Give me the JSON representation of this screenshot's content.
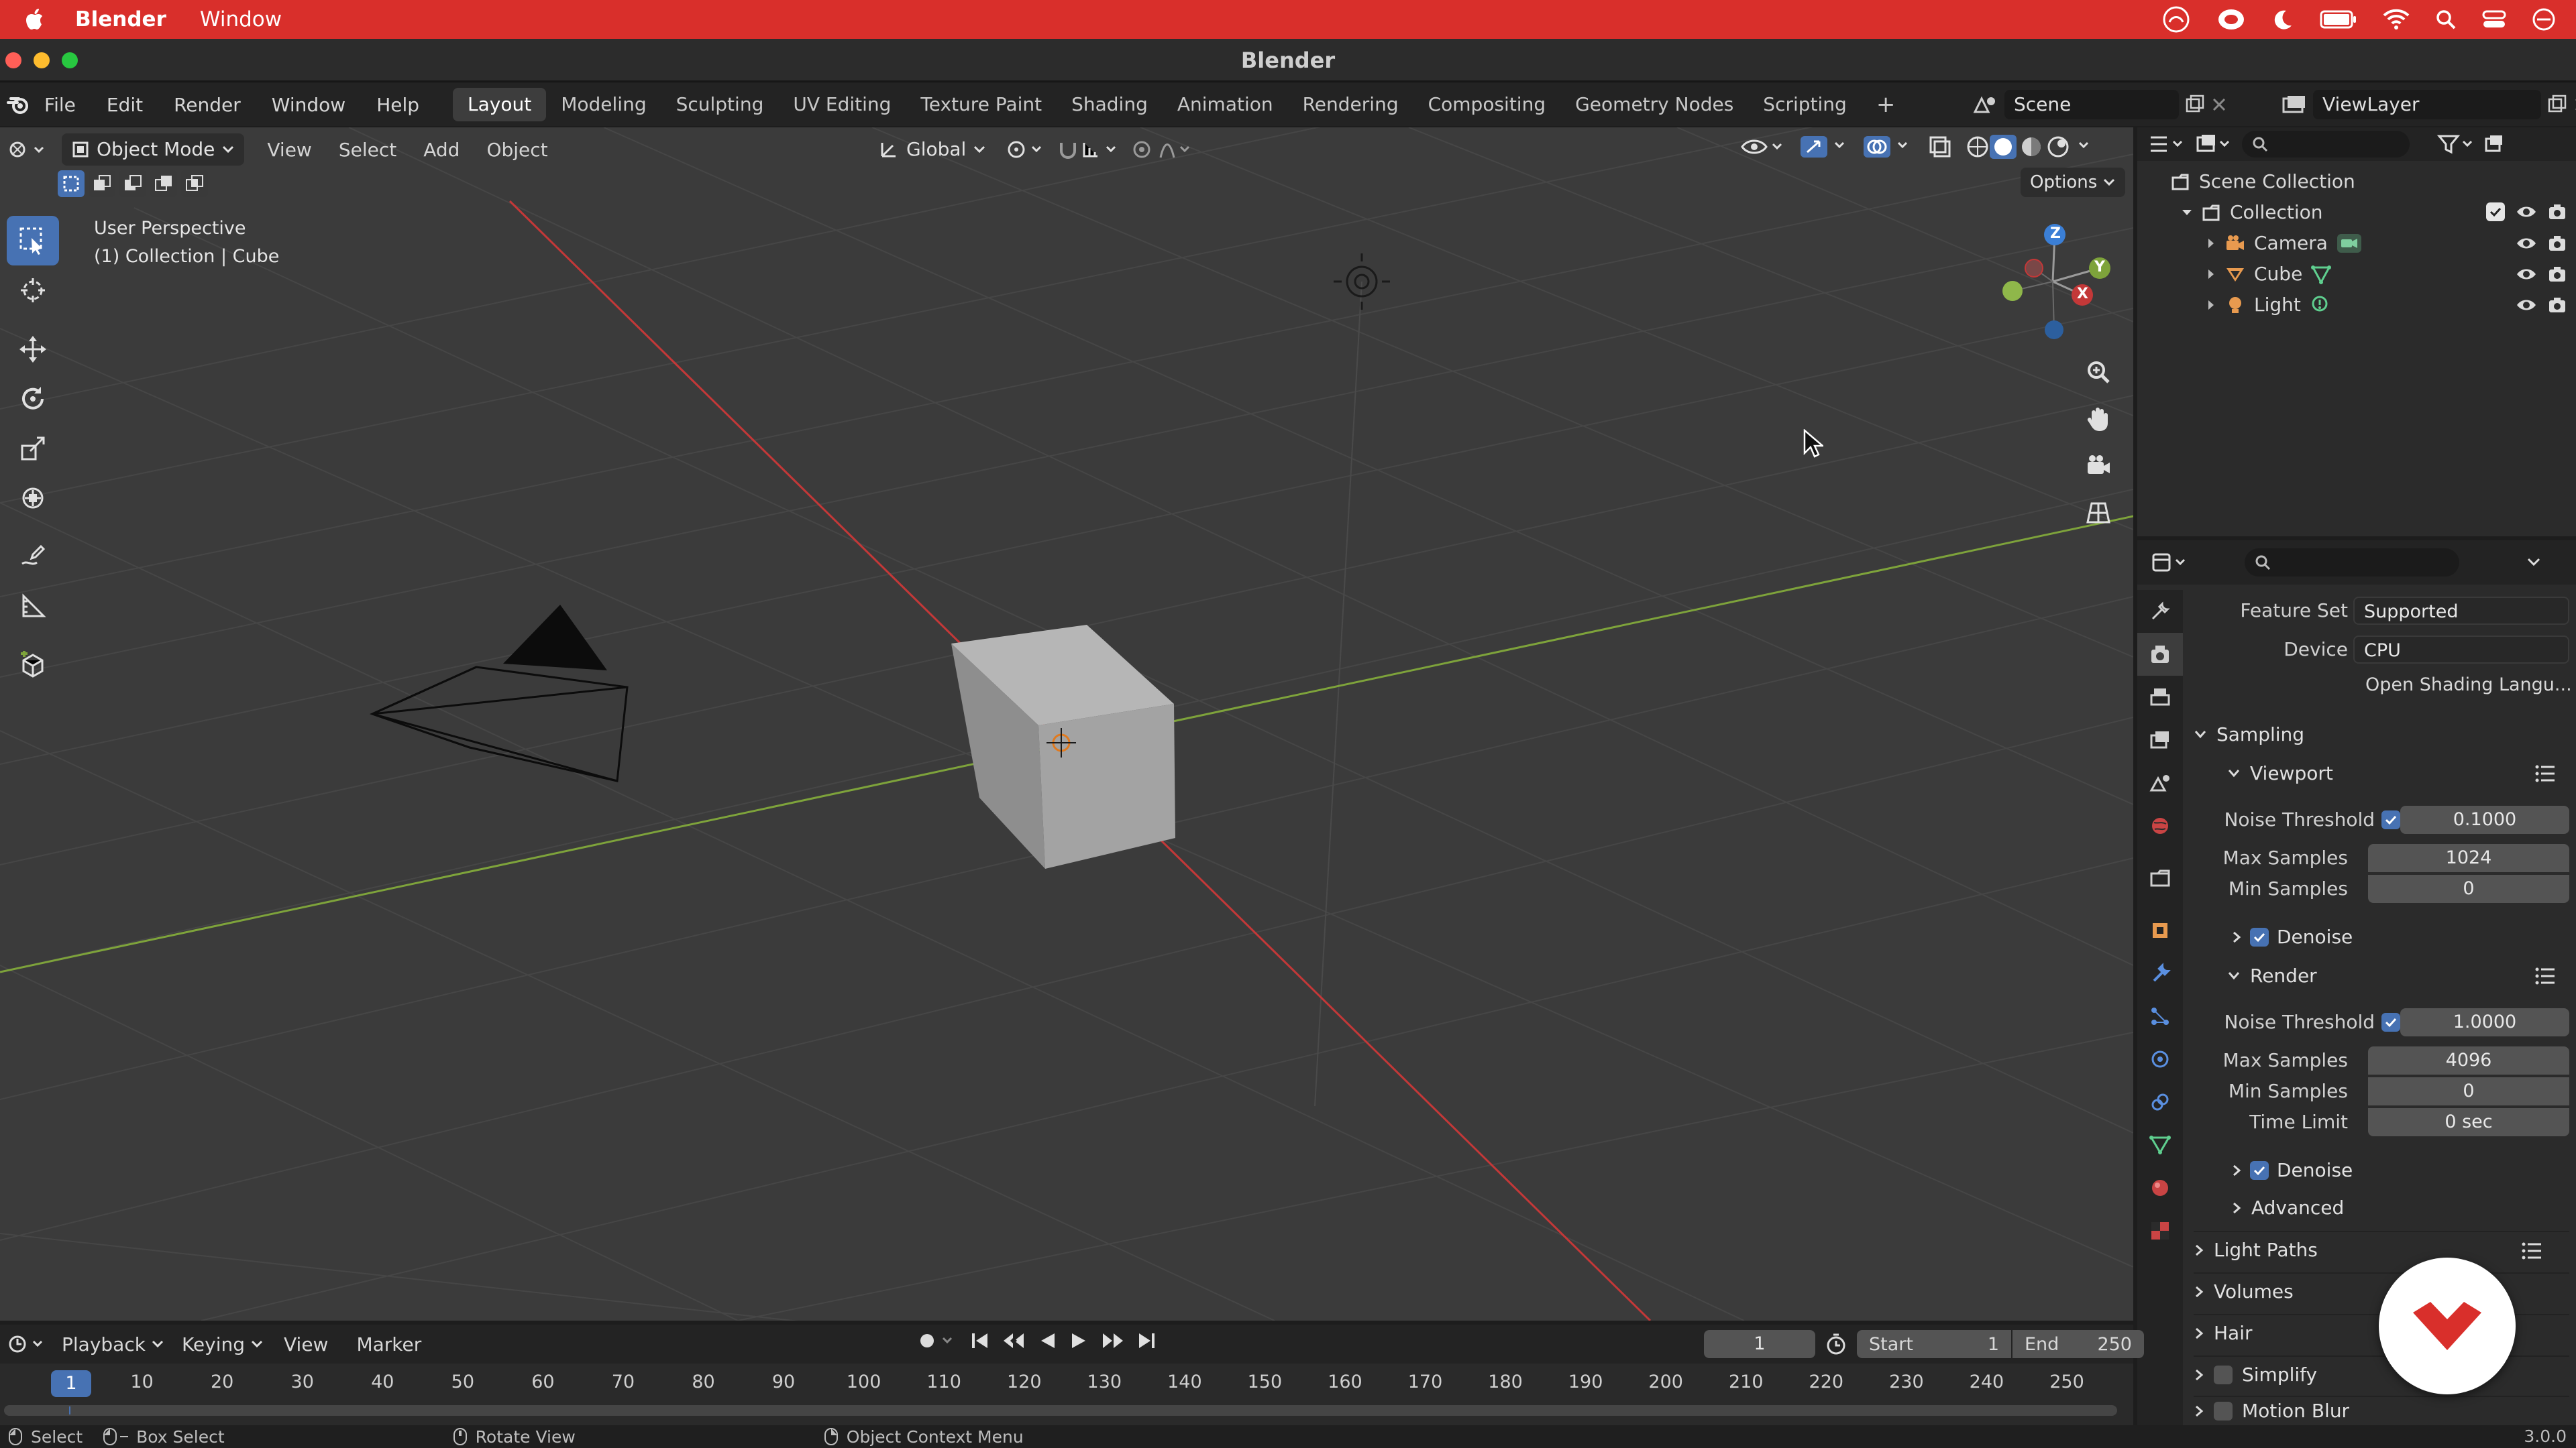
{
  "mac_menubar": {
    "app_name": "Blender",
    "items": [
      "Window"
    ],
    "accent_color": "#d92f2b"
  },
  "window": {
    "title": "Blender"
  },
  "topbar": {
    "menus": [
      "File",
      "Edit",
      "Render",
      "Window",
      "Help"
    ],
    "workspaces": [
      "Layout",
      "Modeling",
      "Sculpting",
      "UV Editing",
      "Texture Paint",
      "Shading",
      "Animation",
      "Rendering",
      "Compositing",
      "Geometry Nodes",
      "Scripting"
    ],
    "active_workspace": "Layout",
    "add_tab": "+",
    "scene": "Scene",
    "view_layer": "ViewLayer"
  },
  "viewport": {
    "mode": "Object Mode",
    "menus": [
      "View",
      "Select",
      "Add",
      "Object"
    ],
    "orientation": "Global",
    "options_label": "Options",
    "overlay_title": "User Perspective",
    "overlay_subtitle": "(1) Collection | Cube",
    "gizmo_axes": {
      "z": "Z",
      "y": "Y",
      "x": "X"
    }
  },
  "outliner": {
    "root": "Scene Collection",
    "collection": "Collection",
    "items": [
      {
        "name": "Camera",
        "icon": "camera-icon"
      },
      {
        "name": "Cube",
        "icon": "mesh-icon"
      },
      {
        "name": "Light",
        "icon": "light-icon"
      }
    ]
  },
  "properties": {
    "feature_set_label": "Feature Set",
    "feature_set_value": "Supported",
    "device_label": "Device",
    "device_value": "CPU",
    "osl_label": "Open Shading Langu...",
    "sampling": {
      "title": "Sampling",
      "viewport": {
        "title": "Viewport",
        "noise_threshold_label": "Noise Threshold",
        "noise_threshold": "0.1000",
        "max_samples_label": "Max Samples",
        "max_samples": "1024",
        "min_samples_label": "Min Samples",
        "min_samples": "0",
        "denoise_label": "Denoise"
      },
      "render": {
        "title": "Render",
        "noise_threshold_label": "Noise Threshold",
        "noise_threshold": "1.0000",
        "max_samples_label": "Max Samples",
        "max_samples": "4096",
        "min_samples_label": "Min Samples",
        "min_samples": "0",
        "time_limit_label": "Time Limit",
        "time_limit": "0 sec",
        "denoise_label": "Denoise"
      },
      "advanced": "Advanced"
    },
    "panels": [
      "Light Paths",
      "Volumes",
      "Hair",
      "Simplify",
      "Motion Blur"
    ]
  },
  "timeline": {
    "menus": [
      "Playback",
      "Keying",
      "View",
      "Marker"
    ],
    "current_frame": "1",
    "start_label": "Start",
    "start": "1",
    "end_label": "End",
    "end": "250",
    "ticks": [
      "1",
      "10",
      "20",
      "30",
      "40",
      "50",
      "60",
      "70",
      "80",
      "90",
      "100",
      "110",
      "120",
      "130",
      "140",
      "150",
      "160",
      "170",
      "180",
      "190",
      "200",
      "210",
      "220",
      "230",
      "240",
      "250"
    ]
  },
  "statusbar": {
    "select": "Select",
    "box_select": "Box Select",
    "rotate_view": "Rotate View",
    "context_menu": "Object Context Menu",
    "version": "3.0.0"
  },
  "colors": {
    "active_blue": "#4772b3",
    "x_axis": "#c33838",
    "y_axis": "#7ea33b",
    "z_axis": "#3b7fd6"
  }
}
